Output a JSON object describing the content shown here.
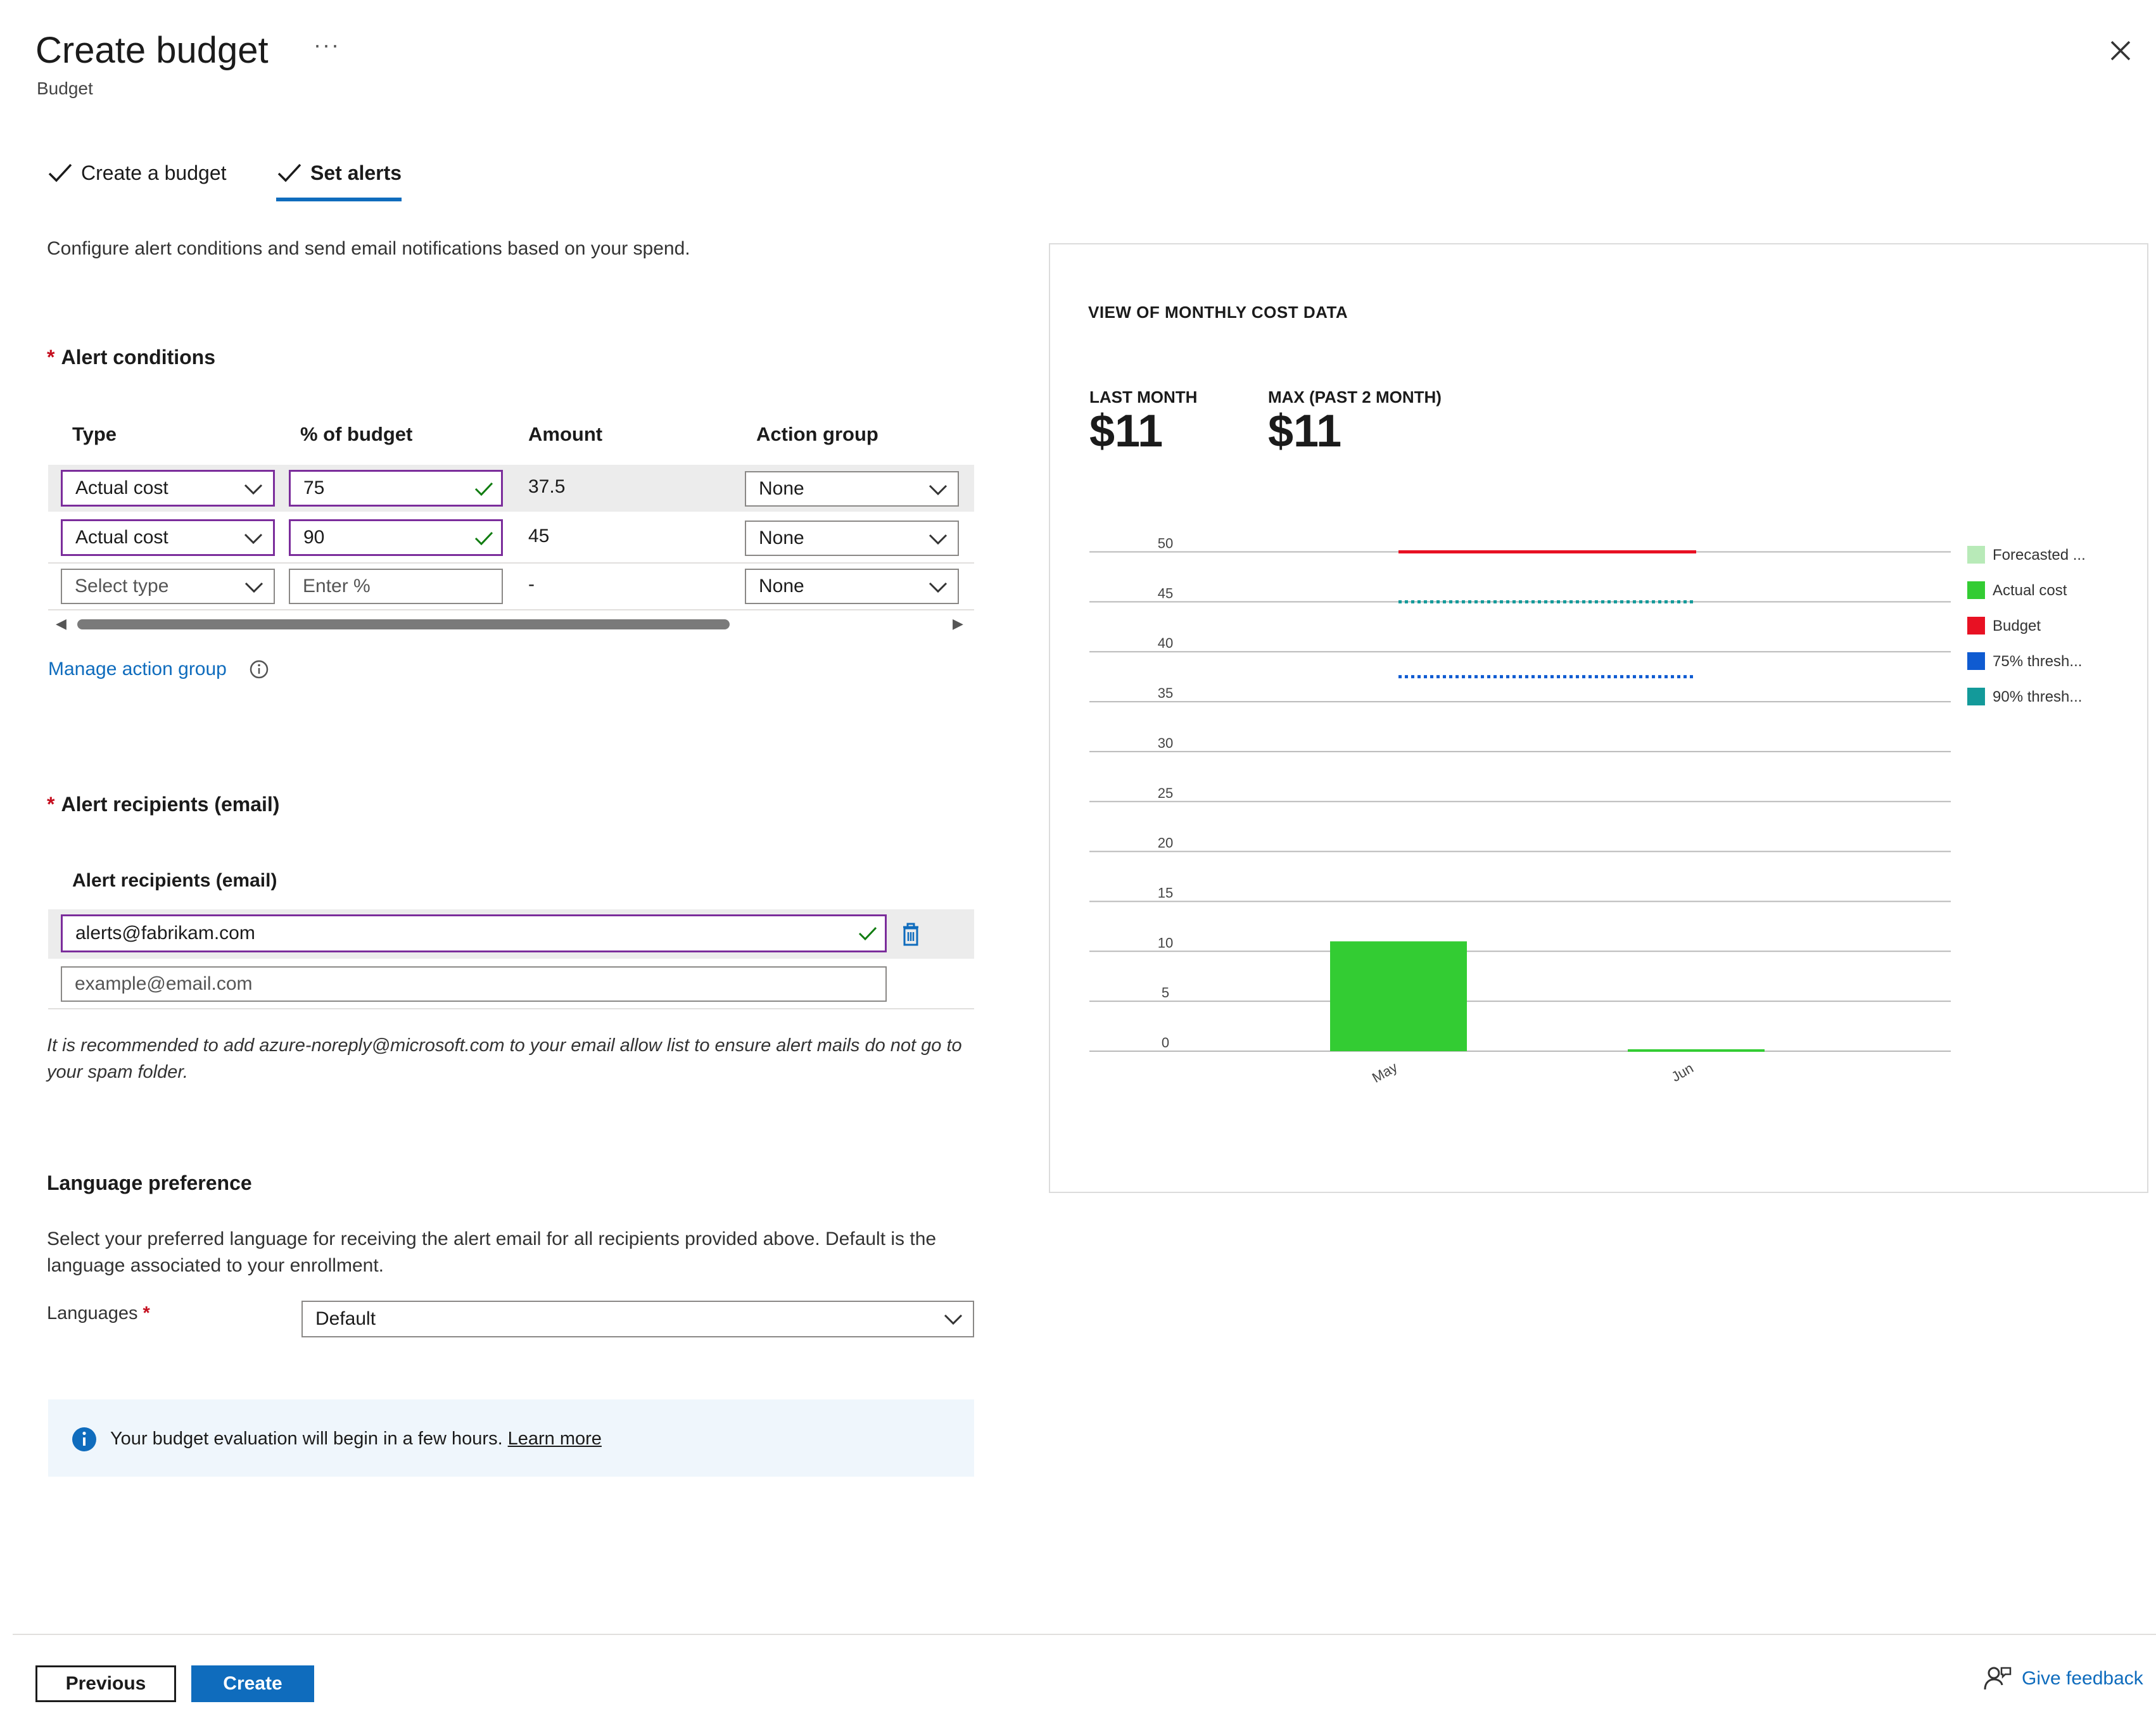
{
  "header": {
    "title": "Create budget",
    "more": "···",
    "subtitle": "Budget"
  },
  "tabs": [
    {
      "label": "Create a budget"
    },
    {
      "label": "Set alerts"
    }
  ],
  "description": "Configure alert conditions and send email notifications based on your spend.",
  "alert_conditions": {
    "heading": "Alert conditions",
    "columns": [
      "Type",
      "% of budget",
      "Amount",
      "Action group"
    ],
    "rows": [
      {
        "type": "Actual cost",
        "percent": "75",
        "amount": "37.5",
        "action_group": "None"
      },
      {
        "type": "Actual cost",
        "percent": "90",
        "amount": "45",
        "action_group": "None"
      },
      {
        "type": "Select type",
        "percent": "Enter %",
        "amount": "-",
        "action_group": "None"
      }
    ],
    "manage_link": "Manage action group"
  },
  "recipients": {
    "heading": "Alert recipients (email)",
    "column_label": "Alert recipients (email)",
    "email_value": "alerts@fabrikam.com",
    "email_placeholder": "example@email.com",
    "note": "It is recommended to add azure-noreply@microsoft.com to your email allow list to ensure alert mails do not go to your spam folder."
  },
  "language": {
    "heading": "Language preference",
    "description": "Select your preferred language for receiving the alert email for all recipients provided above. Default is the language associated to your enrollment.",
    "label": "Languages",
    "value": "Default"
  },
  "info_bar": {
    "text": "Your budget evaluation will begin in a few hours.",
    "link": "Learn more"
  },
  "chart_panel": {
    "title": "VIEW OF MONTHLY COST DATA",
    "kpis": [
      {
        "label": "LAST MONTH",
        "value": "$11"
      },
      {
        "label": "MAX (PAST 2 MONTH)",
        "value": "$11"
      }
    ]
  },
  "chart_data": {
    "type": "bar",
    "categories": [
      "May",
      "Jun"
    ],
    "series": [
      {
        "name": "Actual cost",
        "values": [
          11,
          0
        ],
        "color": "#33cc33"
      }
    ],
    "reference_lines": [
      {
        "name": "Budget",
        "value": 50,
        "color": "#e81123",
        "style": "solid"
      },
      {
        "name": "90% thresh...",
        "value": 45,
        "color": "#139a9a",
        "style": "dotted"
      },
      {
        "name": "75% thresh...",
        "value": 37.5,
        "color": "#0f5bd1",
        "style": "dotted"
      }
    ],
    "legend": [
      {
        "label": "Forecasted ...",
        "color": "#b8eab8"
      },
      {
        "label": "Actual cost",
        "color": "#33cc33"
      },
      {
        "label": "Budget",
        "color": "#e81123"
      },
      {
        "label": "75% thresh...",
        "color": "#0f5bd1"
      },
      {
        "label": "90% thresh...",
        "color": "#139a9a"
      }
    ],
    "yticks": [
      0,
      5,
      10,
      15,
      20,
      25,
      30,
      35,
      40,
      45,
      50
    ],
    "ylim": [
      0,
      52
    ],
    "legend_position": "right"
  },
  "footer": {
    "previous": "Previous",
    "create": "Create",
    "feedback": "Give feedback"
  }
}
